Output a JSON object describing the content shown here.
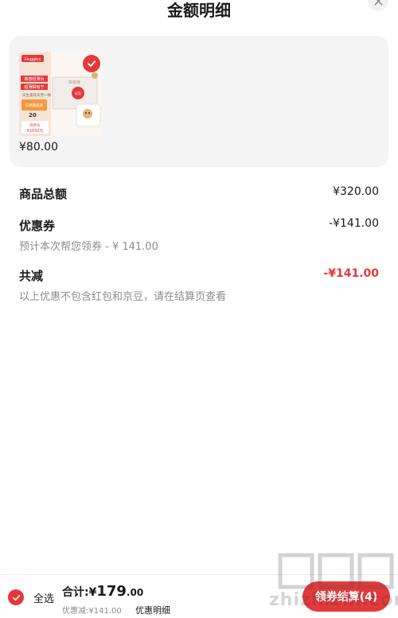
{
  "header": {
    "title": "金额明细"
  },
  "product": {
    "price": "¥80.00",
    "brand_logo": "Huggies",
    "box_lines": [
      "铂金装",
      "好奇"
    ],
    "promo_lines": [
      "裸感轻薄诉",
      "超薄瞬吸干",
      "天生柔软",
      "天然一样",
      "日销量排第",
      "20",
      "到手价",
      "¥1050元"
    ]
  },
  "summary": {
    "goods_total_label": "商品总额",
    "goods_total_value": "¥320.00",
    "coupon_label": "优惠券",
    "coupon_value": "-¥141.00",
    "coupon_sub": "预计本次帮您领券 - ¥ 141.00",
    "reduce_label": "共减",
    "reduce_value": "-¥141.00",
    "reduce_sub": "以上优惠不包含红包和京豆，请在结算页查看"
  },
  "bottom": {
    "select_all": "全选",
    "total_prefix": "合计:¥",
    "total_int": "179",
    "total_cents": ".00",
    "discount_text": "优惠减:¥141.00",
    "detail_link": "优惠明细",
    "checkout_button": "领券结算(4)"
  },
  "watermark": {
    "text": "zhizhizhi.com"
  },
  "colors": {
    "accent": "#e4393c",
    "card_bg": "#f4f4f4"
  }
}
